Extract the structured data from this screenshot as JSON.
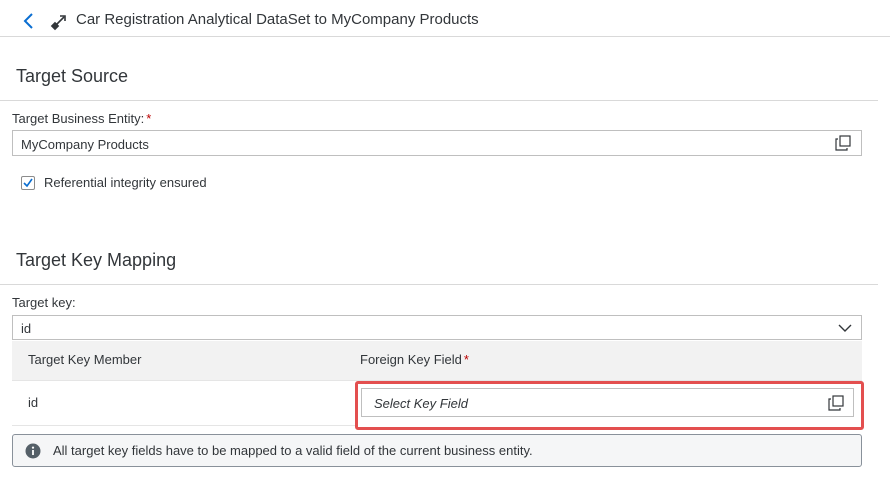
{
  "header": {
    "title": "Car Registration Analytical DataSet to MyCompany Products"
  },
  "target_source": {
    "section_title": "Target Source",
    "business_entity_label": "Target Business Entity:",
    "required_mark": "*",
    "business_entity_value": "MyCompany Products",
    "referential_integrity_label": "Referential integrity ensured",
    "referential_integrity_checked": true
  },
  "target_key_mapping": {
    "section_title": "Target Key Mapping",
    "target_key_label": "Target key:",
    "target_key_value": "id",
    "table": {
      "col_member": "Target Key Member",
      "col_foreign": "Foreign Key Field",
      "required_mark": "*",
      "rows": [
        {
          "member": "id",
          "foreign_placeholder": "Select Key Field"
        }
      ]
    },
    "info_message": "All target key fields have to be mapped to a valid field of the current business entity."
  },
  "colors": {
    "highlight": "#e34f4f",
    "required": "#bb0000",
    "accent": "#0a6ed1"
  }
}
